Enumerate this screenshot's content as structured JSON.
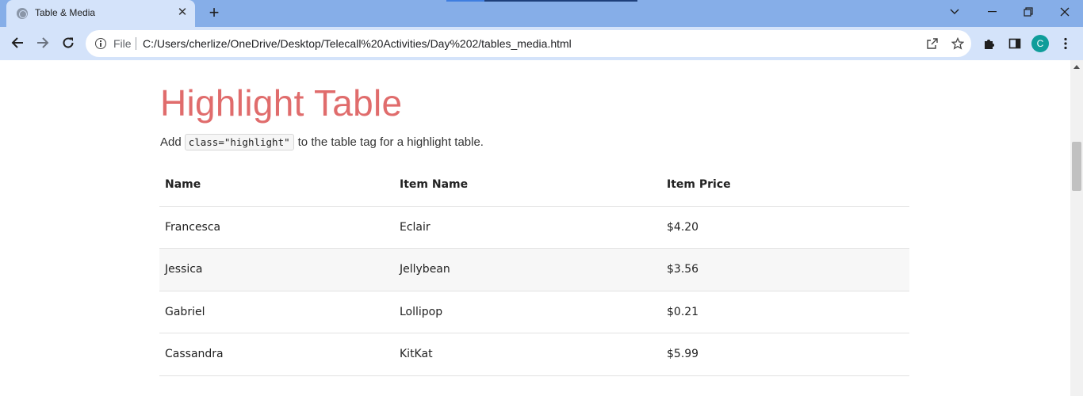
{
  "browser": {
    "tab_title": "Table & Media",
    "url_scheme": "File",
    "url": "C:/Users/cherlize/OneDrive/Desktop/Telecall%20Activities/Day%202/tables_media.html",
    "profile_initial": "C"
  },
  "page": {
    "title": "Highlight Table",
    "intro_before": "Add",
    "intro_code": "class=\"highlight\"",
    "intro_after": "to the table tag for a highlight table."
  },
  "table": {
    "headers": [
      "Name",
      "Item Name",
      "Item Price"
    ],
    "rows": [
      [
        "Francesca",
        "Eclair",
        "$4.20"
      ],
      [
        "Jessica",
        "Jellybean",
        "$3.56"
      ],
      [
        "Gabriel",
        "Lollipop",
        "$0.21"
      ],
      [
        "Cassandra",
        "KitKat",
        "$5.99"
      ]
    ]
  },
  "colors": {
    "title_accent": "#e06c6c",
    "tabstrip": "#86aee8",
    "toolbar": "#d4e3fa",
    "avatar": "#0f9d9a"
  }
}
